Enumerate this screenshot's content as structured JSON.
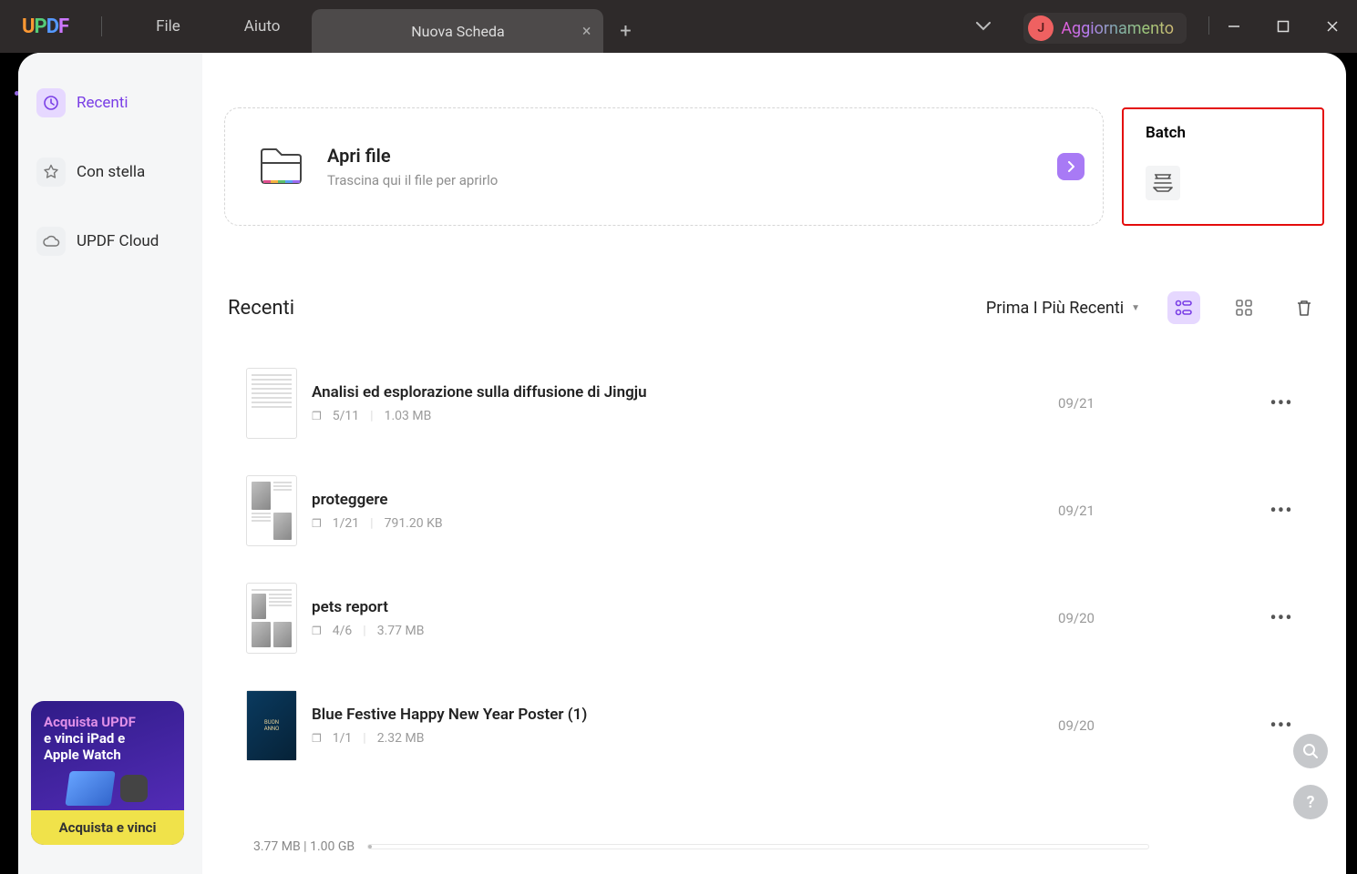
{
  "titlebar": {
    "menus": {
      "file": "File",
      "help": "Aiuto"
    },
    "tab_label": "Nuova Scheda",
    "user_initial": "J",
    "update_label": "Aggiornamento"
  },
  "sidebar": {
    "recent": "Recenti",
    "starred": "Con stella",
    "cloud": "UPDF Cloud"
  },
  "open_card": {
    "title": "Apri file",
    "subtitle": "Trascina qui il file per aprirlo"
  },
  "batch": {
    "title": "Batch"
  },
  "recent": {
    "title": "Recenti",
    "sort_label": "Prima I Più Recenti",
    "items": [
      {
        "name": "Analisi ed esplorazione sulla diffusione di Jingju",
        "pages": "5/11",
        "size": "1.03 MB",
        "date": "09/21"
      },
      {
        "name": "proteggere",
        "pages": "1/21",
        "size": "791.20 KB",
        "date": "09/21"
      },
      {
        "name": "pets report",
        "pages": "4/6",
        "size": "3.77 MB",
        "date": "09/20"
      },
      {
        "name": "Blue Festive Happy New Year Poster (1)",
        "pages": "1/1",
        "size": "2.32 MB",
        "date": "09/20"
      }
    ]
  },
  "footer": {
    "usage": "3.77 MB | 1.00 GB"
  },
  "promo": {
    "line1": "Acquista UPDF",
    "line2a": "e vinci iPad e",
    "line2b": "Apple Watch",
    "cta": "Acquista e vinci"
  }
}
